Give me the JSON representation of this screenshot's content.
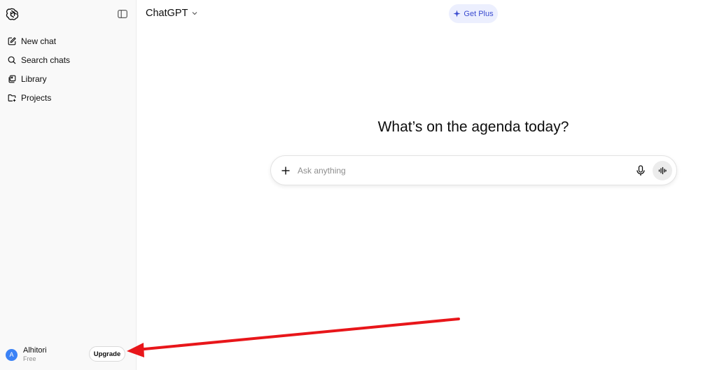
{
  "header": {
    "model_name": "ChatGPT",
    "get_plus_label": "Get Plus"
  },
  "sidebar": {
    "items": [
      {
        "label": "New chat",
        "icon": "edit-icon"
      },
      {
        "label": "Search chats",
        "icon": "search-icon"
      },
      {
        "label": "Library",
        "icon": "library-icon"
      },
      {
        "label": "Projects",
        "icon": "folder-plus-icon"
      }
    ],
    "user": {
      "avatar_initial": "A",
      "name": "Alhitori",
      "plan": "Free",
      "upgrade_label": "Upgrade"
    }
  },
  "main": {
    "headline": "What’s on the agenda today?",
    "composer": {
      "placeholder": "Ask anything"
    }
  },
  "colors": {
    "accent": "#3a4bd0",
    "annotation_arrow": "#e8161a",
    "avatar": "#3b82f6"
  }
}
